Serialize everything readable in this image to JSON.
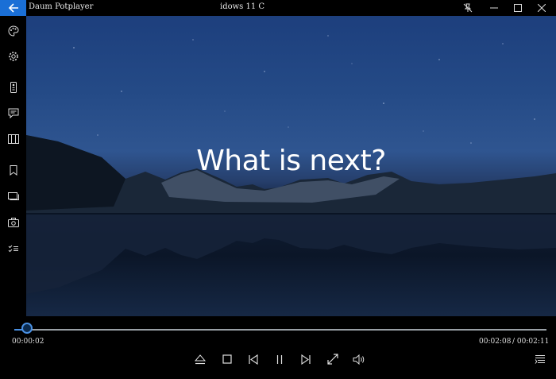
{
  "titlebar": {
    "app_title": "Daum Potplayer",
    "video_title": "idows 11 C"
  },
  "video": {
    "caption": "What is next?"
  },
  "playback": {
    "current_time": "00:00:02",
    "remaining_time": "00:02:08",
    "total_time": "/ 00:02:11",
    "progress_fraction": 0.015
  },
  "colors": {
    "accent": "#1a6fd6",
    "seek_accent": "#4a90e2",
    "background": "#000000"
  },
  "icons": {
    "sidebar": [
      "palette-icon",
      "settings-icon",
      "remote-icon",
      "subtitle-icon",
      "layout-icon",
      "bookmark-icon",
      "window-icon",
      "screenshot-icon",
      "playlist-check-icon"
    ],
    "controls": [
      "eject-icon",
      "stop-icon",
      "previous-icon",
      "pause-icon",
      "next-icon",
      "fullscreen-icon",
      "volume-icon",
      "playlist-icon"
    ]
  }
}
